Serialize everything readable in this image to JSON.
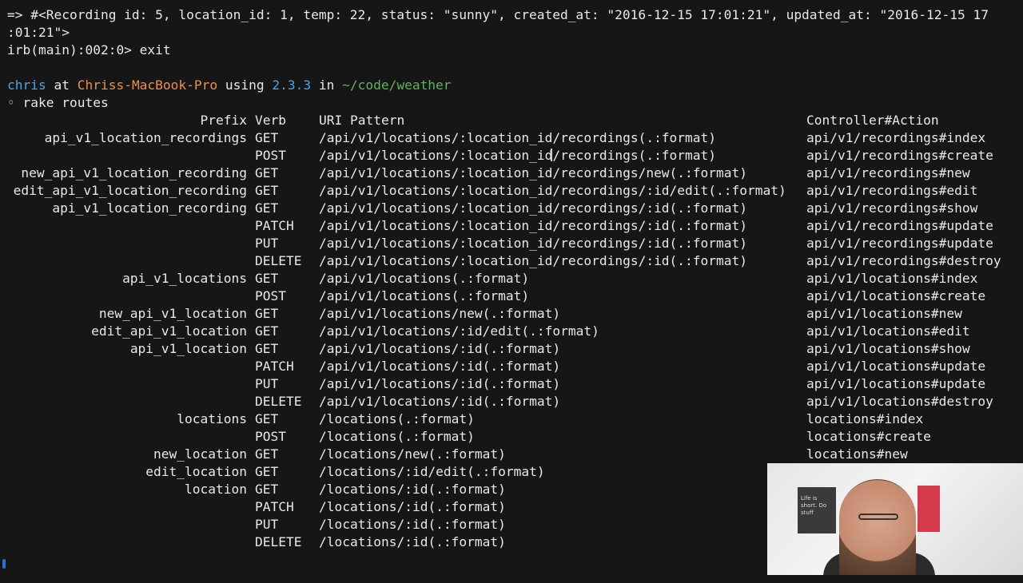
{
  "terminal": {
    "output_line_1": "=> #<Recording id: 5, location_id: 1, temp: 22, status: \"sunny\", created_at: \"2016-12-15 17:01:21\", updated_at: \"2016-12-15 17",
    "output_line_2": ":01:21\">",
    "irb_prompt": "irb(main):002:0> exit",
    "prompt": {
      "user": "chris",
      "at": " at ",
      "host": "Chriss-MacBook-Pro",
      "using": " using ",
      "ruby_version": "2.3.3",
      "in": " in ",
      "path": "~/code/weather"
    },
    "command_bullet": "◦",
    "command": " rake routes",
    "routes_header": {
      "prefix": "Prefix",
      "verb": "Verb",
      "uri": "URI Pattern",
      "action": "Controller#Action"
    },
    "routes": [
      {
        "prefix": "api_v1_location_recordings",
        "verb": "GET",
        "uri": "/api/v1/locations/:location_id/recordings(.:format)",
        "action": "api/v1/recordings#index"
      },
      {
        "prefix": "",
        "verb": "POST",
        "uri": "/api/v1/locations/:location_id/recordings(.:format)",
        "action": "api/v1/recordings#create"
      },
      {
        "prefix": "new_api_v1_location_recording",
        "verb": "GET",
        "uri": "/api/v1/locations/:location_id/recordings/new(.:format)",
        "action": "api/v1/recordings#new"
      },
      {
        "prefix": "edit_api_v1_location_recording",
        "verb": "GET",
        "uri": "/api/v1/locations/:location_id/recordings/:id/edit(.:format)",
        "action": "api/v1/recordings#edit"
      },
      {
        "prefix": "api_v1_location_recording",
        "verb": "GET",
        "uri": "/api/v1/locations/:location_id/recordings/:id(.:format)",
        "action": "api/v1/recordings#show"
      },
      {
        "prefix": "",
        "verb": "PATCH",
        "uri": "/api/v1/locations/:location_id/recordings/:id(.:format)",
        "action": "api/v1/recordings#update"
      },
      {
        "prefix": "",
        "verb": "PUT",
        "uri": "/api/v1/locations/:location_id/recordings/:id(.:format)",
        "action": "api/v1/recordings#update"
      },
      {
        "prefix": "",
        "verb": "DELETE",
        "uri": "/api/v1/locations/:location_id/recordings/:id(.:format)",
        "action": "api/v1/recordings#destroy"
      },
      {
        "prefix": "api_v1_locations",
        "verb": "GET",
        "uri": "/api/v1/locations(.:format)",
        "action": "api/v1/locations#index"
      },
      {
        "prefix": "",
        "verb": "POST",
        "uri": "/api/v1/locations(.:format)",
        "action": "api/v1/locations#create"
      },
      {
        "prefix": "new_api_v1_location",
        "verb": "GET",
        "uri": "/api/v1/locations/new(.:format)",
        "action": "api/v1/locations#new"
      },
      {
        "prefix": "edit_api_v1_location",
        "verb": "GET",
        "uri": "/api/v1/locations/:id/edit(.:format)",
        "action": "api/v1/locations#edit"
      },
      {
        "prefix": "api_v1_location",
        "verb": "GET",
        "uri": "/api/v1/locations/:id(.:format)",
        "action": "api/v1/locations#show"
      },
      {
        "prefix": "",
        "verb": "PATCH",
        "uri": "/api/v1/locations/:id(.:format)",
        "action": "api/v1/locations#update"
      },
      {
        "prefix": "",
        "verb": "PUT",
        "uri": "/api/v1/locations/:id(.:format)",
        "action": "api/v1/locations#update"
      },
      {
        "prefix": "",
        "verb": "DELETE",
        "uri": "/api/v1/locations/:id(.:format)",
        "action": "api/v1/locations#destroy"
      },
      {
        "prefix": "locations",
        "verb": "GET",
        "uri": "/locations(.:format)",
        "action": "locations#index"
      },
      {
        "prefix": "",
        "verb": "POST",
        "uri": "/locations(.:format)",
        "action": "locations#create"
      },
      {
        "prefix": "new_location",
        "verb": "GET",
        "uri": "/locations/new(.:format)",
        "action": "locations#new"
      },
      {
        "prefix": "edit_location",
        "verb": "GET",
        "uri": "/locations/:id/edit(.:format)",
        "action": ""
      },
      {
        "prefix": "location",
        "verb": "GET",
        "uri": "/locations/:id(.:format)",
        "action": ""
      },
      {
        "prefix": "",
        "verb": "PATCH",
        "uri": "/locations/:id(.:format)",
        "action": ""
      },
      {
        "prefix": "",
        "verb": "PUT",
        "uri": "/locations/:id(.:format)",
        "action": ""
      },
      {
        "prefix": "",
        "verb": "DELETE",
        "uri": "/locations/:id(.:format)",
        "action": ""
      }
    ]
  },
  "webcam": {
    "poster_text": "Life is short. Do stuff"
  },
  "colors": {
    "background": "#161616",
    "text": "#e8e8e8",
    "user": "#4fa3e0",
    "host": "#e8904c",
    "version": "#4fa3e0",
    "path": "#5fb25f",
    "marker": "#2b6fd6"
  }
}
